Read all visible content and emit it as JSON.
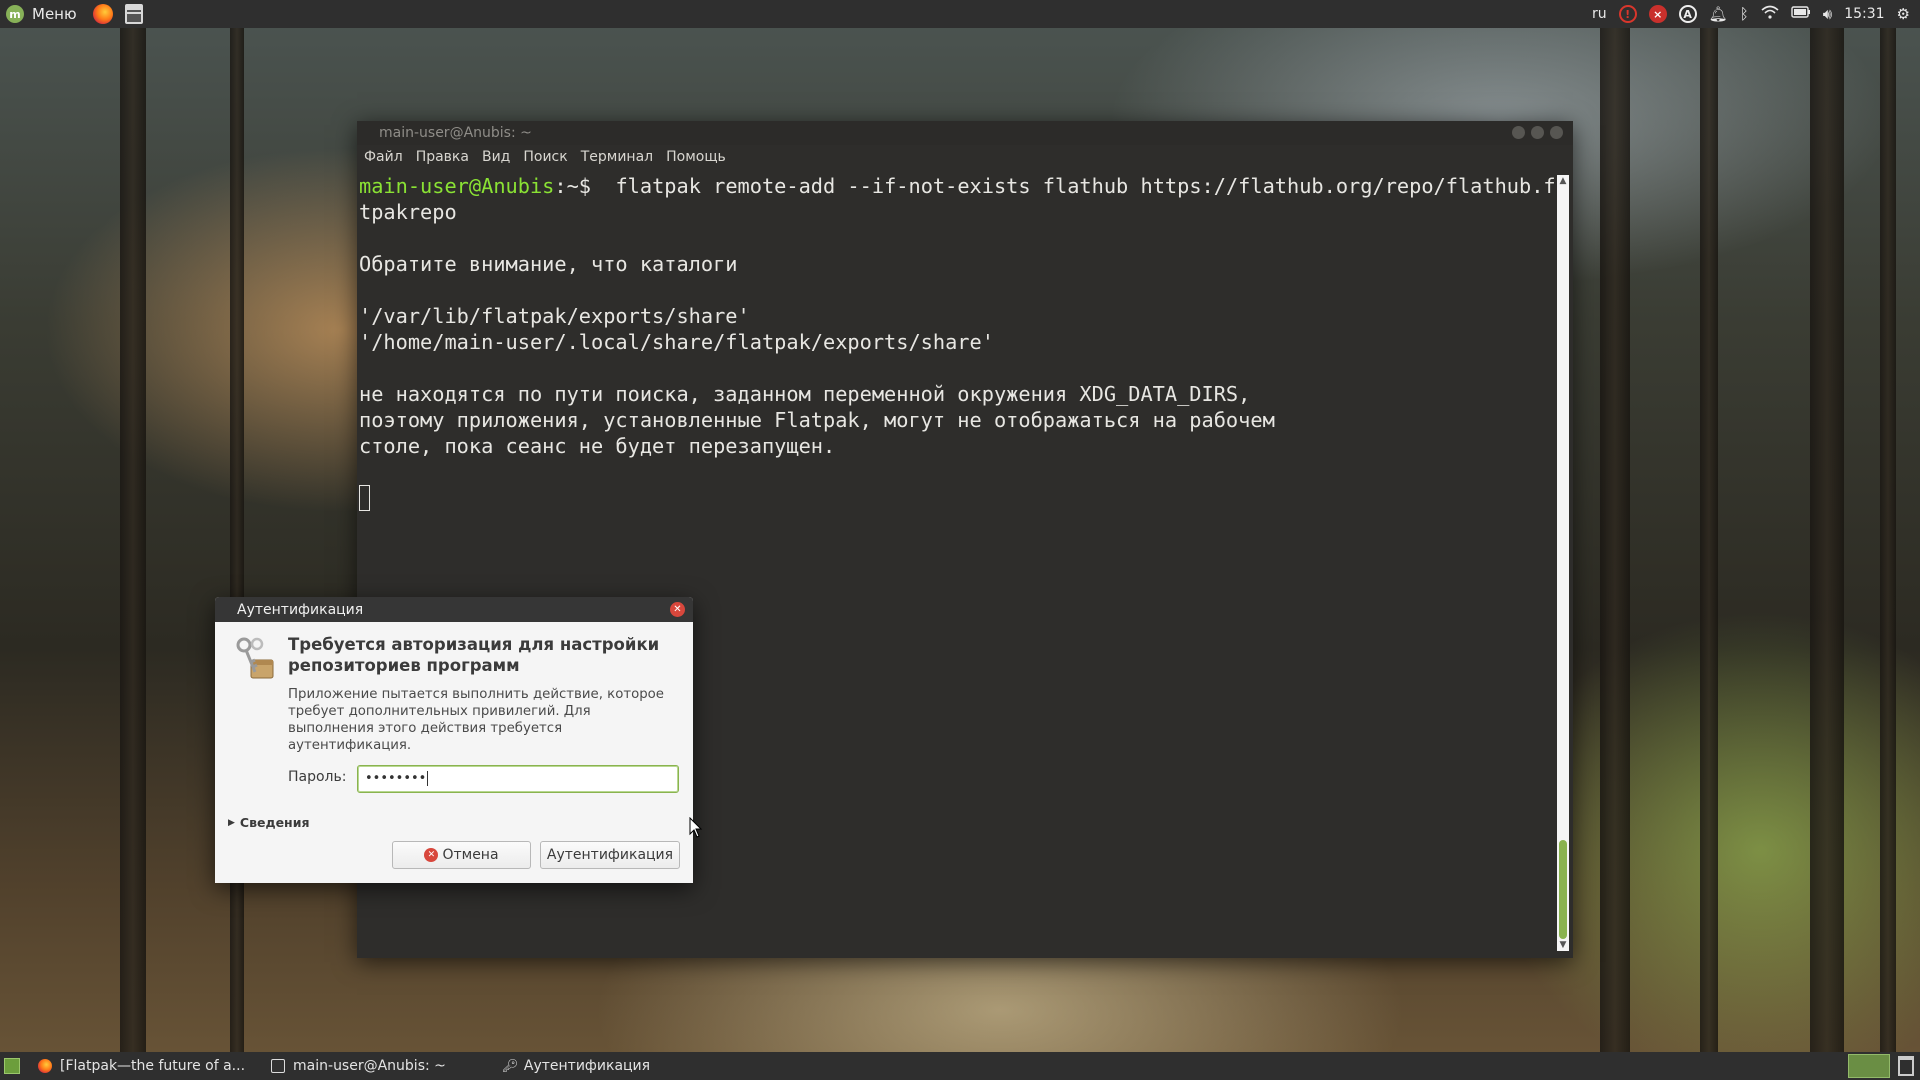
{
  "top_panel": {
    "menu_label": "Меню",
    "keyboard_layout": "ru",
    "clock": "15:31"
  },
  "terminal": {
    "window_title": "main-user@Anubis: ~",
    "menu": [
      "Файл",
      "Правка",
      "Вид",
      "Поиск",
      "Терминал",
      "Помощь"
    ],
    "prompt_user": "main-user@Anubis",
    "prompt_path": ":~$  ",
    "command": "flatpak remote-add --if-not-exists flathub https://flathub.org/repo/flathub.fla",
    "command_wrap": "tpakrepo",
    "output": [
      "",
      "Обратите внимание, что каталоги",
      "",
      "'/var/lib/flatpak/exports/share'",
      "'/home/main-user/.local/share/flatpak/exports/share'",
      "",
      "не находятся по пути поиска, заданном переменной окружения XDG_DATA_DIRS,",
      "поэтому приложения, установленные Flatpak, могут не отображаться на рабочем",
      "столе, пока сеанс не будет перезапущен.",
      ""
    ]
  },
  "auth_dialog": {
    "title": "Аутентификация",
    "heading": "Требуется авторизация для настройки репозиториев программ",
    "description": "Приложение пытается выполнить действие, которое требует дополнительных привилегий. Для выполнения этого действия требуется аутентификация.",
    "password_label": "Пароль:",
    "password_value": "••••••••",
    "details_label": "Сведения",
    "cancel_label": "Отмена",
    "authenticate_label": "Аутентификация"
  },
  "taskbar": {
    "tasks": [
      {
        "label": "[Flatpak—the future of a...",
        "icon": "firefox-icon"
      },
      {
        "label": "main-user@Anubis: ~",
        "icon": "terminal-icon"
      },
      {
        "label": "Аутентификация",
        "icon": "key-icon"
      }
    ]
  },
  "colors": {
    "prompt_green": "#8ae234",
    "accent_green": "#8ab34f",
    "terminal_bg": "#2e2d2b",
    "panel_bg": "#2f2f2f"
  }
}
